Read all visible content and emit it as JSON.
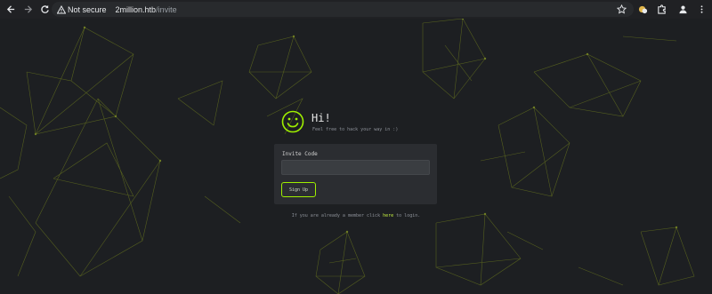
{
  "browser": {
    "security_label": "Not secure",
    "url_host": "2million.htb",
    "url_path": "/invite"
  },
  "page": {
    "greeting": "Hi!",
    "tagline": "Feel free to hack your way in :)",
    "invite_label": "Invite Code",
    "invite_value": "",
    "submit_label": "Sign Up",
    "member_prefix": "If you are already a member click ",
    "member_link": "here",
    "member_suffix": " to login."
  },
  "colors": {
    "background": "#1d1f22",
    "accent": "#9fef00",
    "card": "#2b2d31"
  },
  "icons": [
    "back-arrow-icon",
    "forward-arrow-icon",
    "reload-icon",
    "warning-icon",
    "star-icon",
    "extension-icon",
    "puzzle-icon",
    "profile-icon",
    "menu-dots-icon",
    "smiley-icon"
  ]
}
